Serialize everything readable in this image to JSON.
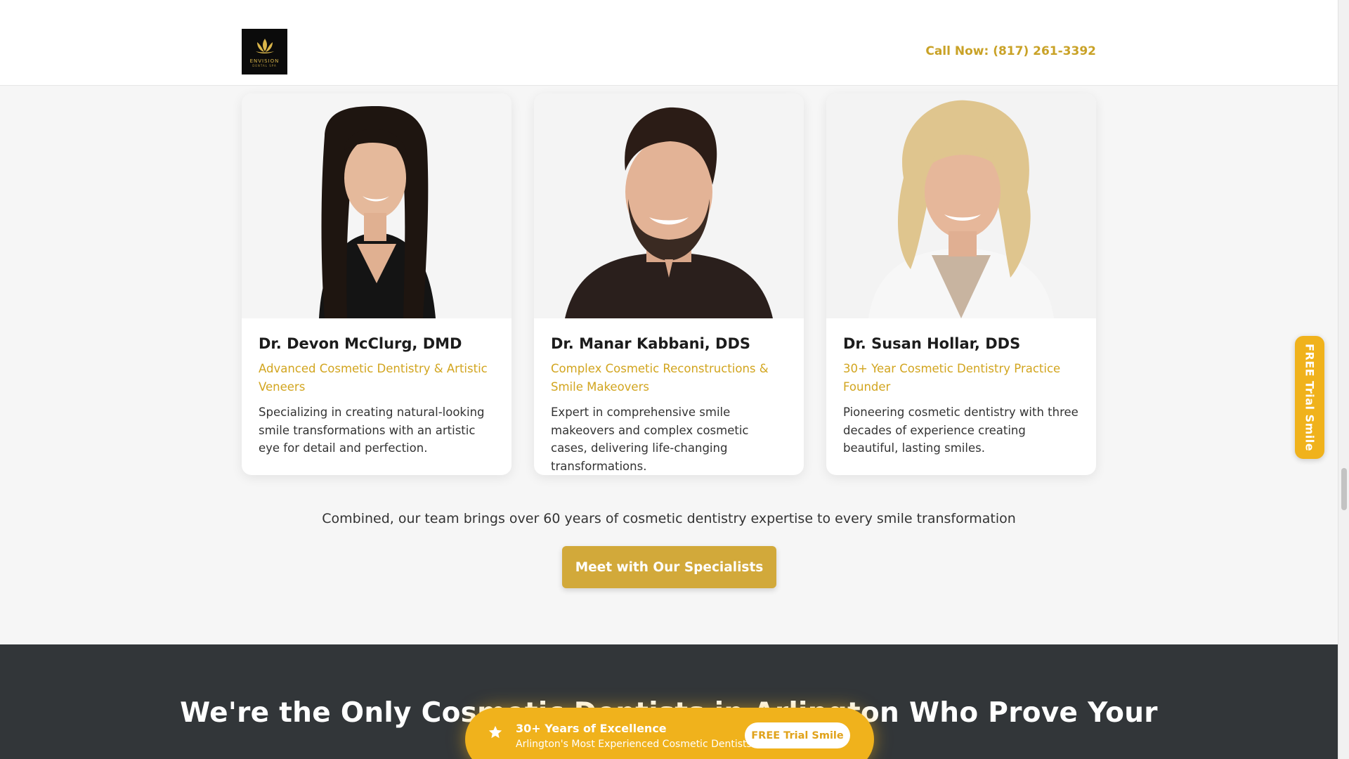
{
  "header": {
    "logo_text": "ENVISION",
    "logo_subtext": "DENTAL SPA",
    "call_now": "Call Now: (817) 261-3392"
  },
  "doctors": [
    {
      "name": "Dr. Devon McClurg, DMD",
      "specialty": "Advanced Cosmetic Dentistry & Artistic Veneers",
      "description": "Specializing in creating natural-looking smile transformations with an artistic eye for detail and perfection."
    },
    {
      "name": "Dr. Manar Kabbani, DDS",
      "specialty": "Complex Cosmetic Reconstructions & Smile Makeovers",
      "description": "Expert in comprehensive smile makeovers and complex cosmetic cases, delivering life-changing transformations."
    },
    {
      "name": "Dr. Susan Hollar, DDS",
      "specialty": "30+ Year Cosmetic Dentistry Practice Founder",
      "description": "Pioneering cosmetic dentistry with three decades of experience creating beautiful, lasting smiles."
    }
  ],
  "summary": "Combined, our team brings over 60 years of cosmetic dentistry expertise to every smile transformation",
  "cta_button": "Meet with Our Specialists",
  "dark_section": {
    "heading": "We're the Only Cosmetic Dentists in Arlington Who Prove Your"
  },
  "side_tab": "FREE Trial Smile",
  "floating_bar": {
    "title": "30+ Years of Excellence",
    "subtitle": "Arlington's Most Experienced Cosmetic Dentists",
    "button": "FREE Trial Smile"
  },
  "colors": {
    "accent": "#d2a51f",
    "button": "#d2a93a",
    "floating": "#f0b21c",
    "dark_section": "#323639"
  }
}
